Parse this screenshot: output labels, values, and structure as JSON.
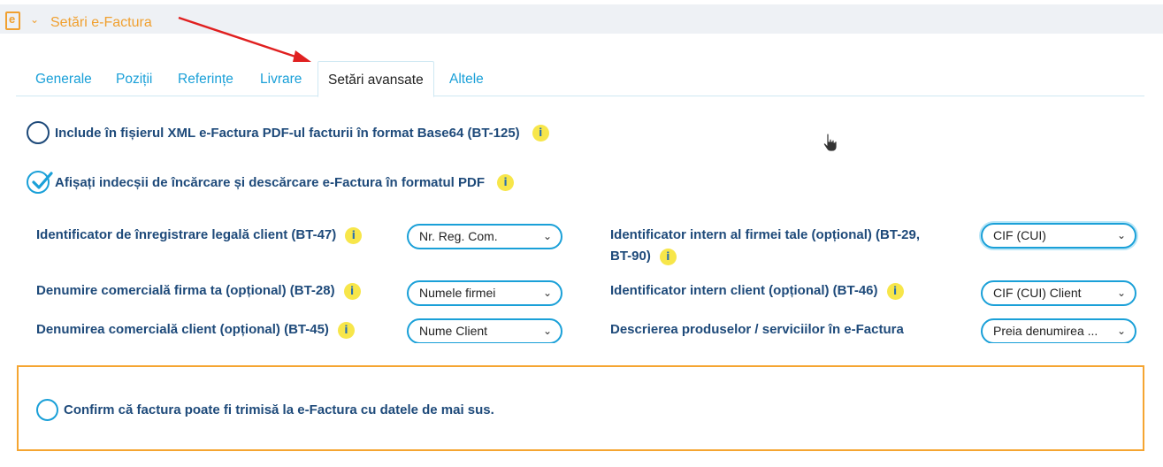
{
  "header": {
    "logo_letter": "e",
    "title": "Setări e-Factura"
  },
  "tabs": [
    "Generale",
    "Poziții",
    "Referințe",
    "Livrare",
    "Setări avansate",
    "Altele"
  ],
  "active_tab_index": 4,
  "options": {
    "include_pdf": {
      "label": "Include în fișierul XML e-Factura PDF-ul facturii în format Base64 (BT-125)",
      "checked": false
    },
    "show_options": {
      "label": "Afișați indecșii de încărcare și descărcare e-Factura în formatul PDF",
      "checked": true
    }
  },
  "info_glyph": "i",
  "fields": {
    "bt47": {
      "label": "Identificator de înregistrare legală client (BT-47)",
      "value": "Nr. Reg. Com."
    },
    "bt28": {
      "label": "Denumire comercială firma ta (opțional) (BT-28)",
      "value": "Numele firmei"
    },
    "bt45": {
      "label": "Denumirea comercială client (opțional) (BT-45)",
      "value": "Nume Client"
    },
    "bt29": {
      "label_line1": "Identificator intern al firmei tale (opțional) (BT-29,",
      "label_line2": "BT-90)",
      "value": "CIF (CUI)"
    },
    "bt46": {
      "label": "Identificator intern client (opțional) (BT-46)",
      "value": "CIF (CUI) Client"
    },
    "desc": {
      "label": "Descrierea produselor / serviciilor în e-Factura",
      "value": "Preia denumirea ..."
    }
  },
  "confirm": {
    "label": "Confirm că factura poate fi trimisă la e-Factura cu datele de mai sus.",
    "checked": false
  },
  "colors": {
    "accent_orange": "#f0a030",
    "link_blue": "#1aa0d8",
    "text_navy": "#1e4a7a",
    "info_yellow": "#f7e64a",
    "annotation_red": "#e02020"
  }
}
